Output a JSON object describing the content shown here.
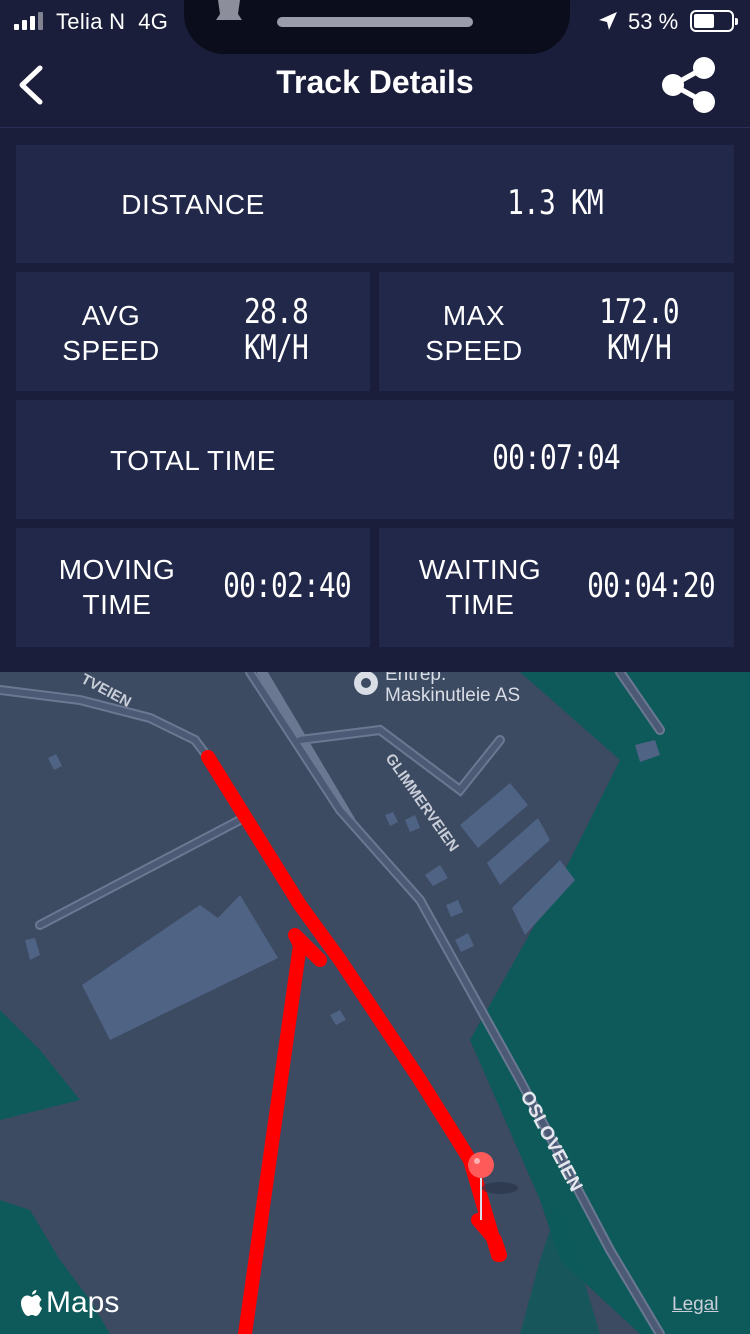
{
  "status": {
    "carrier": "Telia N",
    "network": "4G",
    "battery": "53 %",
    "battery_level": 0.53
  },
  "nav": {
    "title": "Track Details",
    "back_icon": "chevron-left-icon",
    "share_icon": "share-icon"
  },
  "stats": {
    "distance_label": "DISTANCE",
    "distance_value": "1.3 KM",
    "avg_speed_label_1": "AVG",
    "avg_speed_label_2": "SPEED",
    "avg_speed_value_1": "28.8",
    "avg_speed_value_2": "KM/H",
    "max_speed_label_1": "MAX",
    "max_speed_label_2": "SPEED",
    "max_speed_value_1": "172.0",
    "max_speed_value_2": "KM/H",
    "total_time_label": "TOTAL TIME",
    "total_time_value": "00:07:04",
    "moving_time_label_1": "MOVING",
    "moving_time_label_2": "TIME",
    "moving_time_value": "00:02:40",
    "waiting_time_label_1": "WAITING",
    "waiting_time_label_2": "TIME",
    "waiting_time_value": "00:04:20"
  },
  "map": {
    "poi_line_1": "Entrep.",
    "poi_line_2": "Maskinutleie AS",
    "road_1": "TVEIEN",
    "road_2": "GLIMMERVEIEN",
    "road_3": "OSLOVEIEN",
    "attribution": "Maps",
    "legal": "Legal",
    "colors": {
      "land": "#3c4a62",
      "water": "#0e5a5a",
      "track": "#ff0000",
      "pin": "#ff5a5a"
    }
  }
}
